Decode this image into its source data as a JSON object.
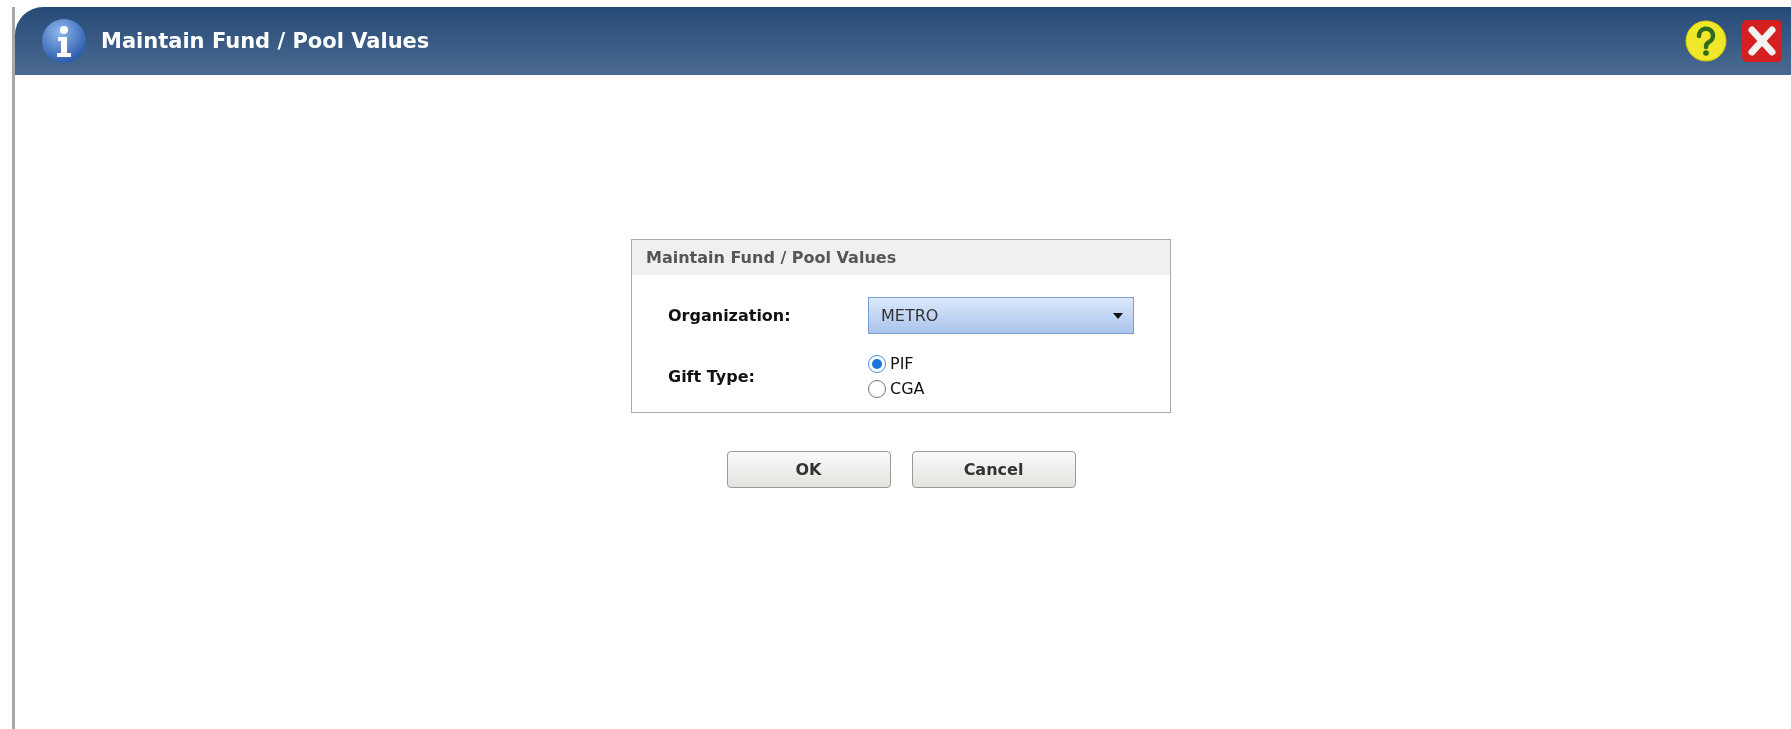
{
  "window": {
    "title": "Maintain Fund / Pool Values"
  },
  "panel": {
    "title": "Maintain Fund / Pool Values",
    "organization": {
      "label": "Organization:",
      "value": "METRO"
    },
    "gift_type": {
      "label": "Gift Type:",
      "options": [
        {
          "label": "PIF",
          "selected": true
        },
        {
          "label": "CGA",
          "selected": false
        }
      ]
    }
  },
  "buttons": [
    "OK",
    "Cancel"
  ]
}
